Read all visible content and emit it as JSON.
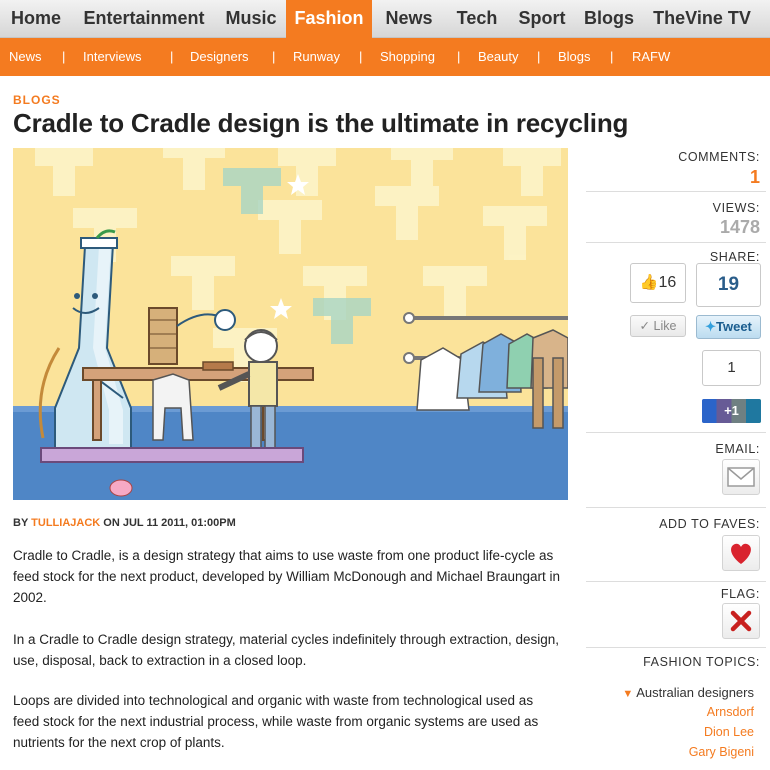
{
  "topnav": {
    "items": [
      "Home",
      "Entertainment",
      "Music",
      "Fashion",
      "News",
      "Tech",
      "Sport",
      "Blogs",
      "TheVine TV"
    ],
    "active": "Fashion"
  },
  "subnav": {
    "items": [
      "News",
      "Interviews",
      "Designers",
      "Runway",
      "Shopping",
      "Beauty",
      "Blogs",
      "RAFW"
    ],
    "separator": "|"
  },
  "article": {
    "kicker": "BLOGS",
    "title": "Cradle to Cradle design is the ultimate in recycling",
    "byline_prefix": "BY",
    "author": "TULLIAJACK",
    "byline_suffix": "ON JUL 11 2011, 01:00PM",
    "paragraphs": [
      "Cradle to Cradle, is a design strategy that aims to use waste from one product life-cycle as feed stock for the next product, developed by William McDonough and Michael Braungart in 2002.",
      "In a Cradle to Cradle design strategy, material cycles indefinitely through extraction, design, use, disposal, back to extraction in a closed loop.",
      "Loops are divided into technological and organic with waste from technological used as feed stock for the next industrial process, while waste from organic systems are used as nutrients for the next crop of plants."
    ]
  },
  "sidebar": {
    "comments_label": "COMMENTS:",
    "comments_count": "1",
    "views_label": "VIEWS:",
    "views_count": "1478",
    "share_label": "SHARE:",
    "facebook_count": "16",
    "facebook_button": "Like",
    "twitter_count": "19",
    "twitter_button": "Tweet",
    "gplus_count": "1",
    "gplus_button": "+1",
    "email_label": "EMAIL:",
    "faves_label": "ADD TO FAVES:",
    "flag_label": "FLAG:",
    "topics_label": "FASHION TOPICS:",
    "topic_group": "Australian designers",
    "topics": [
      "Arnsdorf",
      "Dion Lee",
      "Gary Bigeni"
    ]
  },
  "colors": {
    "brand_orange": "#f47b20",
    "hero_sky": "#fbe39a",
    "hero_floor": "#4f86c6",
    "twitter_blue": "#2a5d8a",
    "heart_red": "#d9232e",
    "flag_red": "#c8201e"
  }
}
